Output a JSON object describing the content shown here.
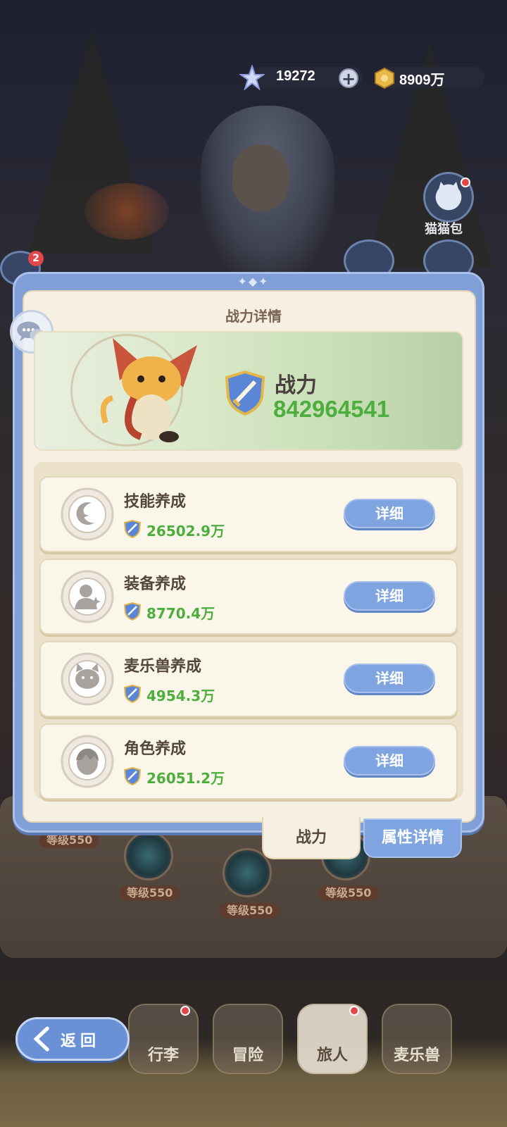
{
  "currency": {
    "diamond": "19272",
    "gold": "8909万"
  },
  "side": {
    "cat_bag_label": "猫猫包",
    "left_badge": "2"
  },
  "modal": {
    "title": "战力详情",
    "power_label": "战力",
    "power_value": "842964541",
    "rows": [
      {
        "title": "技能养成",
        "value": "26502.9万",
        "button": "详细",
        "icon": "moon-star-icon"
      },
      {
        "title": "装备养成",
        "value": "8770.4万",
        "button": "详细",
        "icon": "figure-sparkle-icon"
      },
      {
        "title": "麦乐兽养成",
        "value": "4954.3万",
        "button": "详细",
        "icon": "cat-face-icon"
      },
      {
        "title": "角色养成",
        "value": "26051.2万",
        "button": "详细",
        "icon": "character-head-icon"
      }
    ]
  },
  "tabs": {
    "power": "战力",
    "attributes": "属性详情"
  },
  "background": {
    "levels": [
      "等级550",
      "等级550",
      "等级550",
      "等级550"
    ]
  },
  "nav": {
    "back": "返回",
    "items": [
      "行李",
      "冒险",
      "旅人",
      "麦乐兽"
    ]
  },
  "colors": {
    "accent_blue": "#7fa4e0",
    "power_green": "#4cae3c",
    "panel_cream": "#f6f0e3"
  }
}
